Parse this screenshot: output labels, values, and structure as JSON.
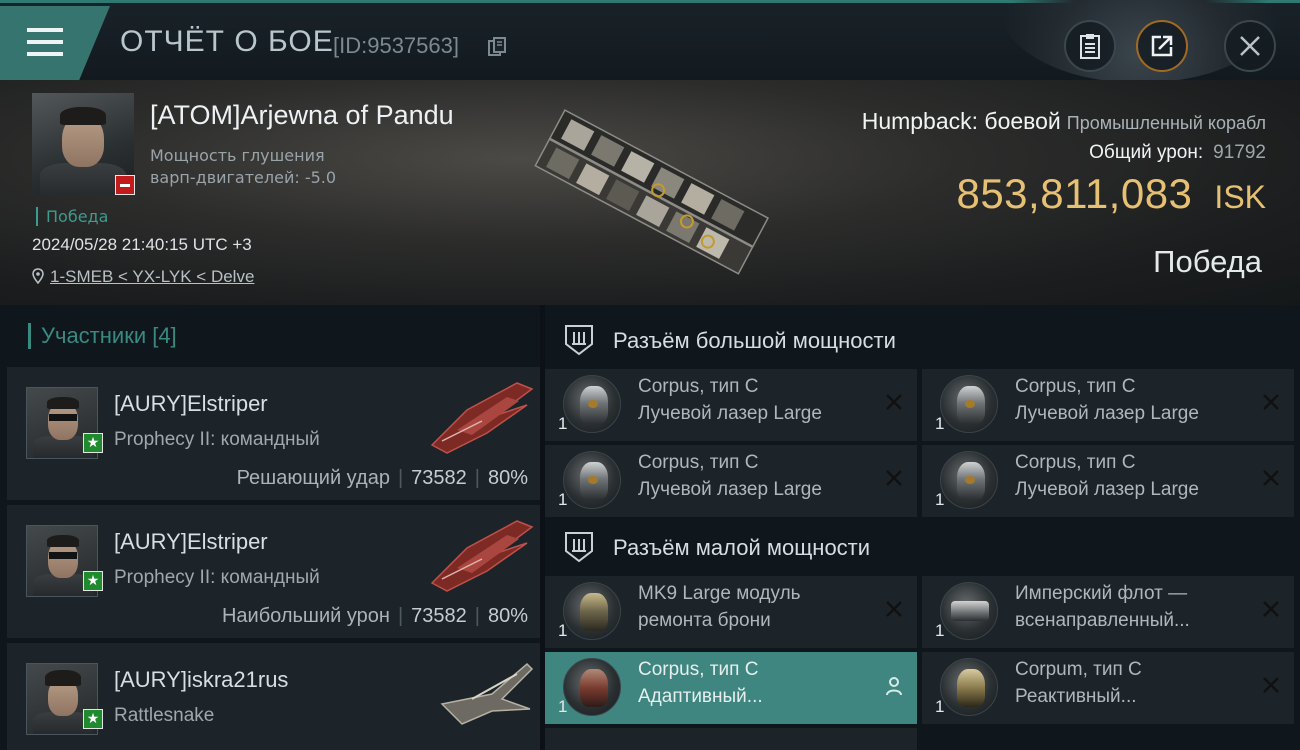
{
  "header": {
    "title": "ОТЧЁТ О БОЕ",
    "id": "[ID:9537563]"
  },
  "victim": {
    "name": "[ATOM]Arjewna of Pandu",
    "stat_line1": "Мощность глушения",
    "stat_line2": "варп-двигателей: -5.0",
    "result_tag": "Победа",
    "datetime": "2024/05/28 21:40:15 UTC +3",
    "location": "1-SMEB < YX-LYK < Delve",
    "ship_name": "Humpback: боевой",
    "ship_class": "Промышленный корабл",
    "total_damage_label": "Общий урон:",
    "total_damage": "91792",
    "isk_value": "853,811,083",
    "isk_currency": "ISK",
    "result_big": "Победа"
  },
  "participants": {
    "title": "Участники [4]",
    "items": [
      {
        "name": "[AURY]Elstriper",
        "ship": "Prophecy II: командный",
        "label": "Решающий удар",
        "damage": "73582",
        "percent": "80%"
      },
      {
        "name": "[AURY]Elstriper",
        "ship": "Prophecy II: командный",
        "label": "Наибольший урон",
        "damage": "73582",
        "percent": "80%"
      },
      {
        "name": "[AURY]iskra21rus",
        "ship": "Rattlesnake",
        "label": "",
        "damage": "",
        "percent": ""
      }
    ]
  },
  "modules": {
    "high_title": "Разъём большой мощности",
    "low_title": "Разъём малой мощности",
    "high": [
      {
        "qty": "1",
        "line1": "Corpus, тип C",
        "line2": "Лучевой лазер Large"
      },
      {
        "qty": "1",
        "line1": "Corpus, тип C",
        "line2": "Лучевой лазер Large"
      },
      {
        "qty": "1",
        "line1": "Corpus, тип C",
        "line2": "Лучевой лазер Large"
      },
      {
        "qty": "1",
        "line1": "Corpus, тип C",
        "line2": "Лучевой лазер Large"
      }
    ],
    "low": [
      {
        "qty": "1",
        "line1": "MK9 Large модуль",
        "line2": "ремонта брони"
      },
      {
        "qty": "1",
        "line1": "Имперский флот —",
        "line2": "всенаправленный..."
      },
      {
        "qty": "1",
        "line1": "Corpus, тип C",
        "line2": "Адаптивный..."
      },
      {
        "qty": "1",
        "line1": "Corpum, тип C",
        "line2": "Реактивный..."
      }
    ]
  },
  "colors": {
    "accent": "#3a8a82",
    "isk": "#e6c073",
    "active_row": "#3f8580",
    "red_badge": "#c11b1b",
    "green_badge": "#1f8a2e"
  },
  "icons": [
    "menu-icon",
    "copy-icon",
    "clipboard-icon",
    "share-icon",
    "close-icon",
    "pin-icon",
    "high-slot-icon",
    "low-slot-icon",
    "remove-icon",
    "person-icon",
    "star-icon"
  ]
}
